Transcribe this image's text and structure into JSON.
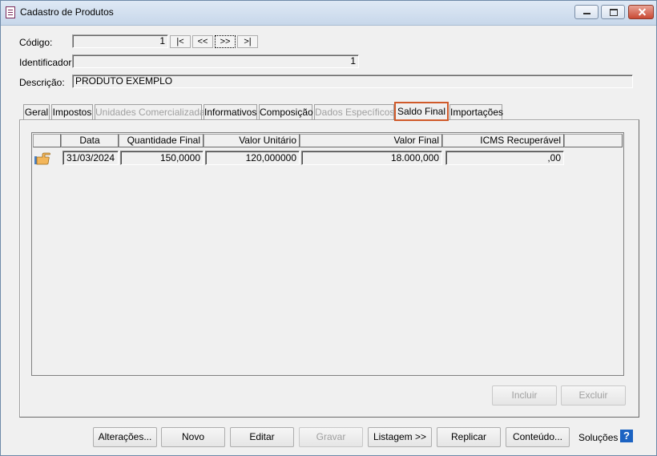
{
  "window": {
    "title": "Cadastro de Produtos"
  },
  "form": {
    "codigo_label": "Código:",
    "codigo_value": "1",
    "identificador_label": "Identificador:",
    "identificador_value": "1",
    "descricao_label": "Descrição:",
    "descricao_value": "PRODUTO EXEMPLO",
    "nav": [
      "|<",
      "<<",
      ">>",
      ">|"
    ]
  },
  "tabs": [
    {
      "label": "Geral",
      "state": "normal"
    },
    {
      "label": "Impostos",
      "state": "normal"
    },
    {
      "label": "Unidades Comercializadas",
      "state": "disabled"
    },
    {
      "label": "Informativos",
      "state": "normal"
    },
    {
      "label": "Composição",
      "state": "normal"
    },
    {
      "label": "Dados Específicos",
      "state": "disabled"
    },
    {
      "label": "Saldo Final",
      "state": "active"
    },
    {
      "label": "Importações",
      "state": "normal"
    }
  ],
  "grid": {
    "headers": [
      "Data",
      "Quantidade Final",
      "Valor Unitário",
      "Valor Final",
      "ICMS Recuperável"
    ],
    "rows": [
      {
        "data": "31/03/2024",
        "quantidade_final": "150,0000",
        "valor_unitario": "120,000000",
        "valor_final": "18.000,000",
        "icms_recuperavel": ",00"
      }
    ],
    "row_indicator_icon": "pointing-hand-icon"
  },
  "grid_buttons": {
    "incluir": "Incluir",
    "excluir": "Excluir"
  },
  "bottom_buttons": {
    "alteracoes": "Alterações...",
    "novo": "Novo",
    "editar": "Editar",
    "gravar": "Gravar",
    "listagem": "Listagem >>",
    "replicar": "Replicar",
    "conteudo": "Conteúdo...",
    "solucoes": "Soluções"
  },
  "colors": {
    "active_tab_outline": "#d05a2a",
    "help_icon": "#1c63c2"
  }
}
